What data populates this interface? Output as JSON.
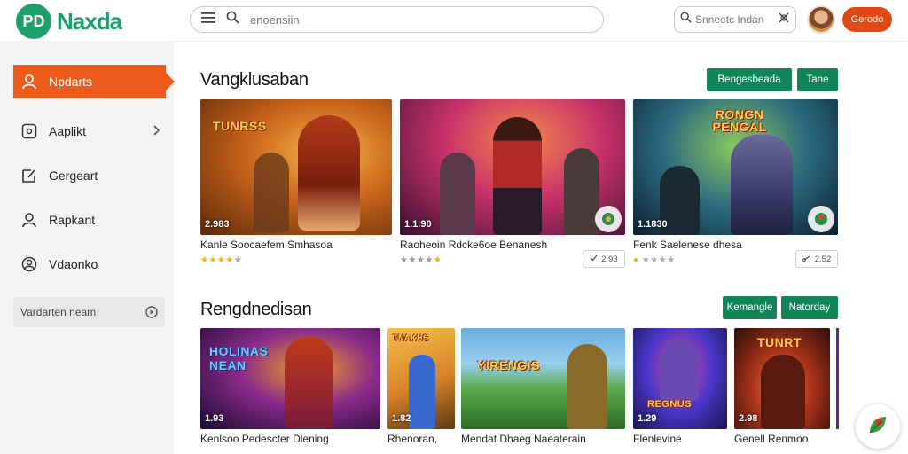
{
  "header": {
    "logo_mark": "PD",
    "logo_text": "Naxda",
    "search_placeholder": "enoensiin",
    "secondary_search_placeholder": "Snneetc Indan",
    "signin_label": "Gerodo"
  },
  "sidebar": {
    "items": [
      {
        "label": "Npdarts",
        "icon": "user-outline-icon",
        "active": true
      },
      {
        "label": "Aaplikt",
        "icon": "app-icon",
        "active": false,
        "has_chevron": true
      },
      {
        "label": "Gergeart",
        "icon": "edit-icon",
        "active": false
      },
      {
        "label": "Rapkant",
        "icon": "user-icon",
        "active": false
      },
      {
        "label": "Vdaonko",
        "icon": "user-circle-icon",
        "active": false
      }
    ],
    "box_label": "Vardarten neam"
  },
  "sections": [
    {
      "title": "Vangklusaban",
      "chips": [
        "Bengesbeada",
        "Tane"
      ],
      "cards": [
        {
          "title": "Kanle Soocaefem Smhasoa",
          "price": "2.983",
          "stars_on": 4,
          "thumb_text": "TUNRSS",
          "colors": [
            "#e58a1f",
            "#7a3210",
            "#f5c24a"
          ]
        },
        {
          "title": "Raoheoin Rdcke6oe Benanesh",
          "price": "1.1.90",
          "stars_on": 4,
          "rating_text": "2.93",
          "thumb_text": "",
          "colors": [
            "#c8326a",
            "#5b1a3a",
            "#ef7b3c"
          ]
        },
        {
          "title": "Fenk Saelenese dhesa",
          "price": "1.1830",
          "stars_on": 1,
          "rating_text": "2.52",
          "thumb_text": "RONGN PENGAL",
          "colors": [
            "#2b6a7f",
            "#1d3246",
            "#6fb24a"
          ]
        }
      ]
    },
    {
      "title": "Rengdnedisan",
      "chips": [
        "Kemangle",
        "Natorday"
      ],
      "cards": [
        {
          "title": "Kenlsoo Pedescter Dlening",
          "price": "1.93",
          "thumb_text": "HOLINAS NEAN",
          "colors": [
            "#6a2a9a",
            "#2a1240",
            "#f0a020"
          ]
        },
        {
          "title": "Rhenoran,",
          "price": "1.82",
          "thumb_text": "TNAKHS",
          "colors": [
            "#e9a23b",
            "#7a4a12",
            "#3a7ad0"
          ]
        },
        {
          "title": "Mendat Dhaeg Naeaterain",
          "price": "",
          "thumb_text": "YIRENGIS",
          "colors": [
            "#5aaa4a",
            "#2c6f9e",
            "#cfe08a"
          ]
        },
        {
          "title": "Flenlevine",
          "price": "1.29",
          "thumb_text": "REGNUS",
          "colors": [
            "#4a36c8",
            "#1a1450",
            "#e044a0"
          ]
        },
        {
          "title": "Genell Renmoo",
          "price": "2.98",
          "thumb_text": "TUNRT",
          "colors": [
            "#a8321a",
            "#2a0e08",
            "#f0881e"
          ]
        }
      ]
    }
  ]
}
